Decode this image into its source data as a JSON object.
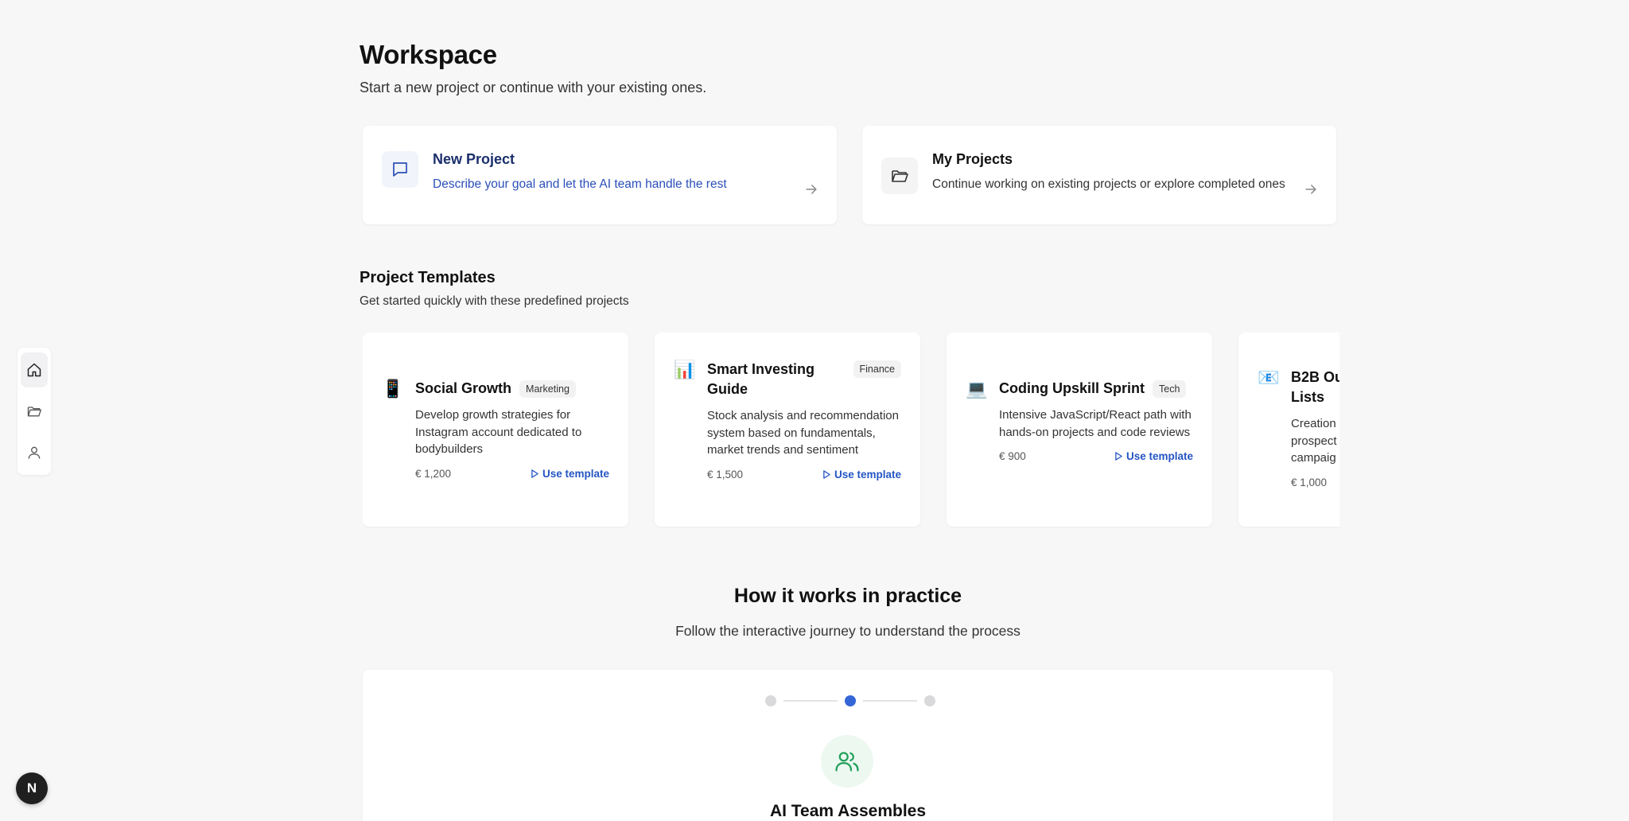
{
  "rail": {
    "items": [
      {
        "icon": "home-icon",
        "active": true
      },
      {
        "icon": "folder-icon",
        "active": false
      },
      {
        "icon": "user-icon",
        "active": false
      }
    ]
  },
  "badge": {
    "label": "N"
  },
  "header": {
    "title": "Workspace",
    "subtitle": "Start a new project or continue with your existing ones."
  },
  "actions": {
    "new_project": {
      "title": "New Project",
      "description": "Describe your goal and let the AI team handle the rest"
    },
    "my_projects": {
      "title": "My Projects",
      "description": "Continue working on existing projects or explore completed ones"
    }
  },
  "templates_section": {
    "title": "Project Templates",
    "subtitle": "Get started quickly with these predefined projects",
    "use_label": "Use template",
    "items": [
      {
        "emoji": "📱",
        "name": "Social Growth",
        "tag": "Marketing",
        "description": "Develop growth strategies for Instagram account dedicated to bodybuilders",
        "price": "€  1,200"
      },
      {
        "emoji": "📊",
        "name": "Smart Investing Guide",
        "tag": "Finance",
        "description": "Stock analysis and recommendation system based on fundamentals, market trends and sentiment",
        "price": "€  1,500"
      },
      {
        "emoji": "💻",
        "name": "Coding Upskill Sprint",
        "tag": "Tech",
        "description": "Intensive JavaScript/React path with hands-on projects and code reviews",
        "price": "€  900"
      },
      {
        "emoji": "📧",
        "name": "B2B Ou",
        "name_line2": "Lists",
        "description_lines": [
          "Creation",
          "prospect",
          "campaig"
        ],
        "price": "€  1,000"
      }
    ]
  },
  "how": {
    "title": "How it works in practice",
    "subtitle": "Follow the interactive journey to understand the process",
    "current_step": 2,
    "step_count": 3,
    "step_title": "AI Team Assembles"
  }
}
